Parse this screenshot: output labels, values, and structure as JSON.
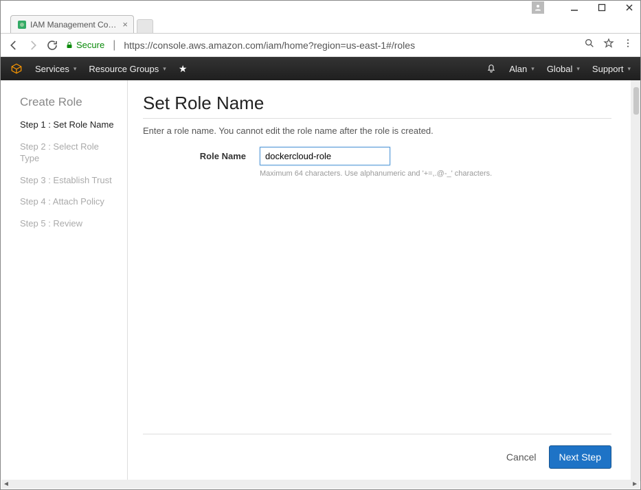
{
  "window": {
    "tab_title": "IAM Management Conso"
  },
  "browser": {
    "secure_label": "Secure",
    "url": "https://console.aws.amazon.com/iam/home?region=us-east-1#/roles"
  },
  "aws_header": {
    "services": "Services",
    "resource_groups": "Resource Groups",
    "user": "Alan",
    "region": "Global",
    "support": "Support"
  },
  "sidebar": {
    "heading": "Create Role",
    "steps": [
      "Step 1 : Set Role Name",
      "Step 2 : Select Role Type",
      "Step 3 : Establish Trust",
      "Step 4 : Attach Policy",
      "Step 5 : Review"
    ],
    "active_index": 0
  },
  "main": {
    "title": "Set Role Name",
    "instruction": "Enter a role name. You cannot edit the role name after the role is created.",
    "field_label": "Role Name",
    "field_value": "dockercloud-role",
    "field_hint": "Maximum 64 characters. Use alphanumeric and '+=,.@-_' characters."
  },
  "footer": {
    "cancel": "Cancel",
    "next": "Next Step"
  }
}
